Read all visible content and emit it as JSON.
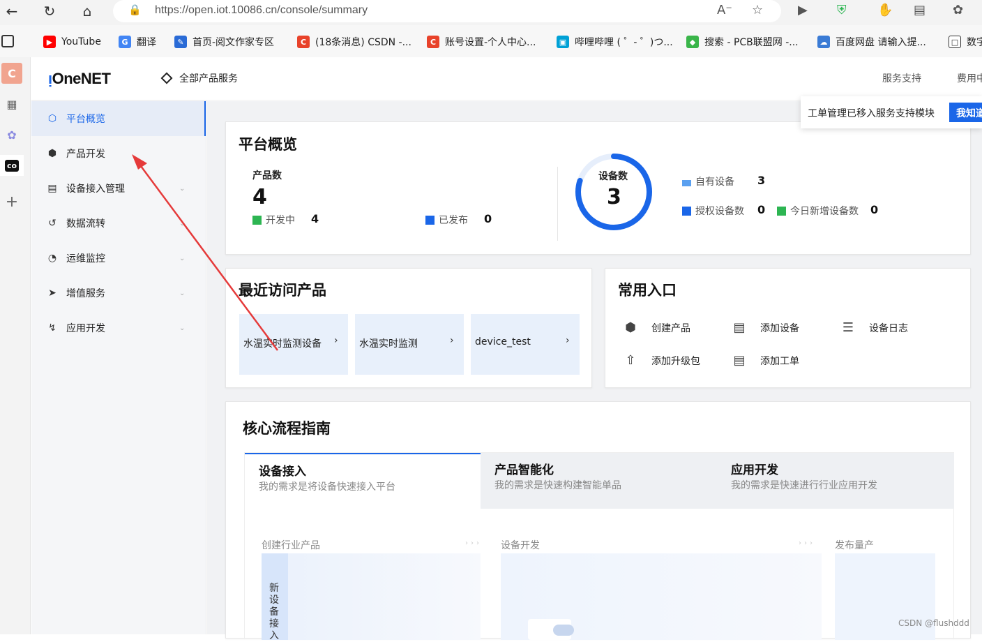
{
  "browser": {
    "url": "https://open.iot.10086.cn/console/summary",
    "bookmarks": [
      {
        "label": "YouTube",
        "color": "#ff0000"
      },
      {
        "label": "翻译",
        "color": "#4285f4"
      },
      {
        "label": "首页-阅文作家专区",
        "color": "#2a6bd6"
      },
      {
        "label": "(18条消息) CSDN -...",
        "color": "#e8422a"
      },
      {
        "label": "账号设置-个人中心...",
        "color": "#e8422a"
      },
      {
        "label": "哔哩哔哩 ( ゜- ゜)つ...",
        "color": "#00a1d6"
      },
      {
        "label": "搜索 - PCB联盟网 -...",
        "color": "#3ab54a"
      },
      {
        "label": "百度网盘 请输入提...",
        "color": "#3a7bd5"
      },
      {
        "label": "数字",
        "color": "#333333"
      }
    ]
  },
  "header": {
    "logo": "OneNET",
    "all_products": "全部产品服务",
    "service_support": "服务支持",
    "fees": "费用中"
  },
  "tooltip": {
    "text": "工单管理已移入服务支持模块",
    "button": "我知道"
  },
  "sidebar": {
    "items": [
      {
        "label": "平台概览"
      },
      {
        "label": "产品开发"
      },
      {
        "label": "设备接入管理"
      },
      {
        "label": "数据流转"
      },
      {
        "label": "运维监控"
      },
      {
        "label": "增值服务"
      },
      {
        "label": "应用开发"
      }
    ]
  },
  "overview": {
    "title": "平台概览",
    "product_count_label": "产品数",
    "product_count": "4",
    "developing_label": "开发中",
    "developing": "4",
    "published_label": "已发布",
    "published": "0",
    "device_count_label": "设备数",
    "device_count": "3",
    "own_devices_label": "自有设备",
    "own_devices": "3",
    "authorized_label": "授权设备数",
    "authorized": "0",
    "new_today_label": "今日新增设备数",
    "new_today": "0"
  },
  "recent": {
    "title": "最近访问产品",
    "items": [
      {
        "label": "水温实时监测设备"
      },
      {
        "label": "水温实时监测"
      },
      {
        "label": "device_test"
      }
    ]
  },
  "common": {
    "title": "常用入口",
    "entries": [
      {
        "label": "创建产品",
        "icon": "cube-icon"
      },
      {
        "label": "添加设备",
        "icon": "add-device-icon"
      },
      {
        "label": "设备日志",
        "icon": "log-icon"
      },
      {
        "label": "添加升级包",
        "icon": "upload-icon"
      },
      {
        "label": "添加工单",
        "icon": "ticket-icon"
      }
    ]
  },
  "guide": {
    "title": "核心流程指南",
    "tabs": [
      {
        "title": "设备接入",
        "desc": "我的需求是将设备快速接入平台"
      },
      {
        "title": "产品智能化",
        "desc": "我的需求是快速构建智能单品"
      },
      {
        "title": "应用开发",
        "desc": "我的需求是快速进行行业应用开发"
      }
    ],
    "stages": [
      "创建行业产品",
      "设备开发",
      "发布量产"
    ],
    "vertical_label": "新设备接入"
  },
  "watermark": "CSDN @flushddd"
}
